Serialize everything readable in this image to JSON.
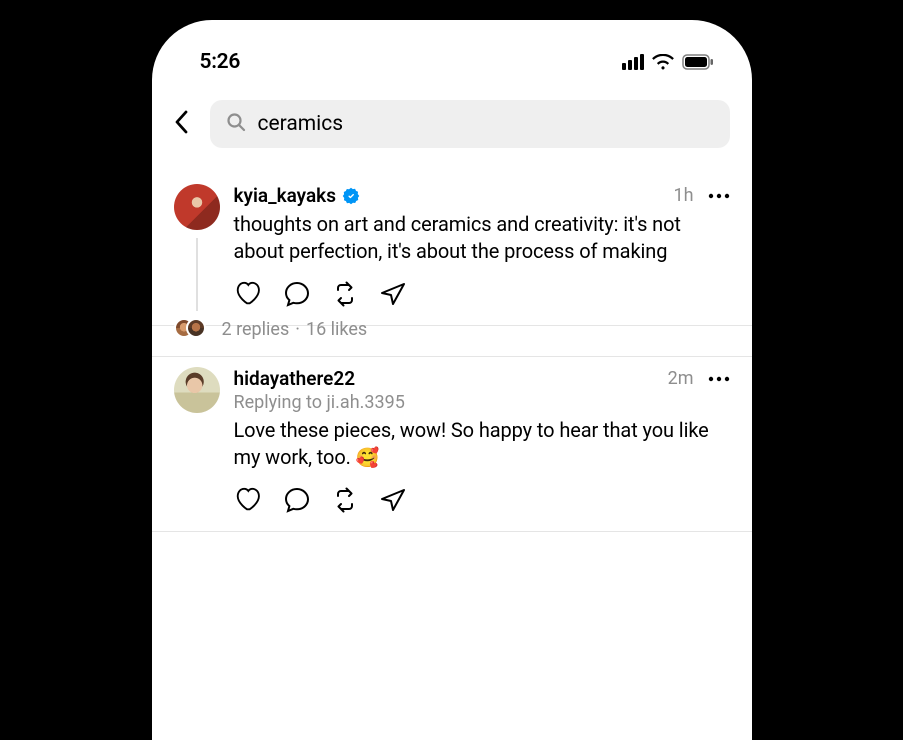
{
  "status": {
    "time": "5:26"
  },
  "search": {
    "query": "ceramics"
  },
  "posts": [
    {
      "username": "kyia_kayaks",
      "verified": true,
      "timestamp": "1h",
      "text": "thoughts on art and ceramics and creativity: it's not about perfection, it's about the process of making",
      "replies_label": "2 replies",
      "likes_label": "16 likes"
    },
    {
      "username": "hidayathere22",
      "verified": false,
      "timestamp": "2m",
      "replying_to": "Replying to ji.ah.3395",
      "text": "Love these pieces, wow! So happy to hear that you like my work, too. ",
      "emoji": "🥰"
    }
  ]
}
